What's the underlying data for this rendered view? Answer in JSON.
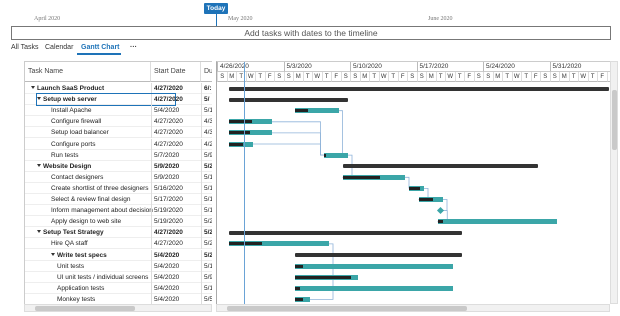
{
  "timeline": {
    "today_label": "Today",
    "months": [
      "April 2020",
      "May 2020",
      "June 2020"
    ],
    "empty_message": "Add tasks with dates to the timeline"
  },
  "tabs": [
    "All Tasks",
    "Calendar",
    "Gantt Chart",
    "···"
  ],
  "active_tab": "Gantt Chart",
  "grid": {
    "headers": [
      "Task Name",
      "Start Date",
      "Du"
    ],
    "rows": [
      {
        "name": "Launch SaaS Product",
        "start": "4/27/2020",
        "dur": "6/:",
        "level": 0,
        "summary": true
      },
      {
        "name": "Setup web server",
        "start": "4/27/2020",
        "dur": "5/",
        "level": 1,
        "summary": true,
        "selected": true
      },
      {
        "name": "Install Apache",
        "start": "5/4/2020",
        "dur": "5/1",
        "level": 2
      },
      {
        "name": "Configure firewall",
        "start": "4/27/2020",
        "dur": "4/3",
        "level": 2
      },
      {
        "name": "Setup load balancer",
        "start": "4/27/2020",
        "dur": "4/3",
        "level": 2
      },
      {
        "name": "Configure ports",
        "start": "4/27/2020",
        "dur": "4/2",
        "level": 2
      },
      {
        "name": "Run tests",
        "start": "5/7/2020",
        "dur": "5/9",
        "level": 2
      },
      {
        "name": "Website Design",
        "start": "5/9/2020",
        "dur": "5/2",
        "level": 1,
        "summary": true
      },
      {
        "name": "Contact designers",
        "start": "5/9/2020",
        "dur": "5/1",
        "level": 2
      },
      {
        "name": "Create shortlist of three designers",
        "start": "5/16/2020",
        "dur": "5/1",
        "level": 2
      },
      {
        "name": "Select & review final design",
        "start": "5/17/2020",
        "dur": "5/1",
        "level": 2
      },
      {
        "name": "Inform management about decision",
        "start": "5/19/2020",
        "dur": "5/1",
        "level": 2
      },
      {
        "name": "Apply design to web site",
        "start": "5/19/2020",
        "dur": "5/2",
        "level": 2
      },
      {
        "name": "Setup Test Strategy",
        "start": "4/27/2020",
        "dur": "5/2",
        "level": 1,
        "summary": true
      },
      {
        "name": "Hire QA staff",
        "start": "4/27/2020",
        "dur": "5/2",
        "level": 2
      },
      {
        "name": "Write test specs",
        "start": "5/4/2020",
        "dur": "5/2",
        "level": 2,
        "summary": true
      },
      {
        "name": "Unit tests",
        "start": "5/4/2020",
        "dur": "5/1",
        "level": 3
      },
      {
        "name": "UI unit tests / individual screens",
        "start": "5/4/2020",
        "dur": "5/9",
        "level": 3
      },
      {
        "name": "Application tests",
        "start": "5/4/2020",
        "dur": "5/1",
        "level": 3
      },
      {
        "name": "Monkey tests",
        "start": "5/4/2020",
        "dur": "5/5",
        "level": 3
      }
    ]
  },
  "gantt": {
    "weeks": [
      "4/26/2020",
      "5/3/2020",
      "5/10/2020",
      "5/17/2020",
      "5/24/2020",
      "5/31/2020"
    ],
    "day_letters": [
      "S",
      "M",
      "T",
      "W",
      "T",
      "F",
      "S"
    ],
    "chart_start": "2020-04-26",
    "bars": [
      {
        "row": 0,
        "type": "summary",
        "start": "2020-04-27",
        "end": "2020-06-30"
      },
      {
        "row": 1,
        "type": "summary",
        "start": "2020-04-27",
        "end": "2020-05-09"
      },
      {
        "row": 2,
        "type": "task",
        "start": "2020-05-04",
        "end": "2020-05-08",
        "progress": 0.3
      },
      {
        "row": 3,
        "type": "task",
        "start": "2020-04-27",
        "end": "2020-05-01",
        "progress": 0.55
      },
      {
        "row": 4,
        "type": "task",
        "start": "2020-04-27",
        "end": "2020-05-01",
        "progress": 0.5
      },
      {
        "row": 5,
        "type": "task",
        "start": "2020-04-27",
        "end": "2020-04-29",
        "progress": 0.6
      },
      {
        "row": 6,
        "type": "task",
        "start": "2020-05-07",
        "end": "2020-05-09",
        "progress": 0.1
      },
      {
        "row": 7,
        "type": "summary",
        "start": "2020-05-09",
        "end": "2020-05-29"
      },
      {
        "row": 8,
        "type": "task",
        "start": "2020-05-09",
        "end": "2020-05-15",
        "progress": 0.6
      },
      {
        "row": 9,
        "type": "task",
        "start": "2020-05-16",
        "end": "2020-05-17",
        "progress": 0.7
      },
      {
        "row": 10,
        "type": "task",
        "start": "2020-05-17",
        "end": "2020-05-19",
        "progress": 0.6
      },
      {
        "row": 12,
        "type": "task",
        "start": "2020-05-19",
        "end": "2020-05-31",
        "progress": 0.05
      },
      {
        "row": 13,
        "type": "summary",
        "start": "2020-04-27",
        "end": "2020-05-21"
      },
      {
        "row": 14,
        "type": "task",
        "start": "2020-04-27",
        "end": "2020-05-07",
        "progress": 0.33
      },
      {
        "row": 15,
        "type": "summary",
        "start": "2020-05-04",
        "end": "2020-05-21"
      },
      {
        "row": 16,
        "type": "task",
        "start": "2020-05-04",
        "end": "2020-05-20",
        "progress": 0.05
      },
      {
        "row": 17,
        "type": "task",
        "start": "2020-05-04",
        "end": "2020-05-10",
        "progress": 0.9
      },
      {
        "row": 18,
        "type": "task",
        "start": "2020-05-04",
        "end": "2020-05-20",
        "progress": 0.03
      },
      {
        "row": 19,
        "type": "task",
        "start": "2020-05-04",
        "end": "2020-05-05",
        "progress": 0.5
      }
    ],
    "milestone": {
      "row": 11,
      "date": "2020-05-19"
    },
    "colors": {
      "task": "#3ba6a8",
      "progress": "#222222",
      "summary": "#333333",
      "today": "#1e73b8"
    }
  }
}
